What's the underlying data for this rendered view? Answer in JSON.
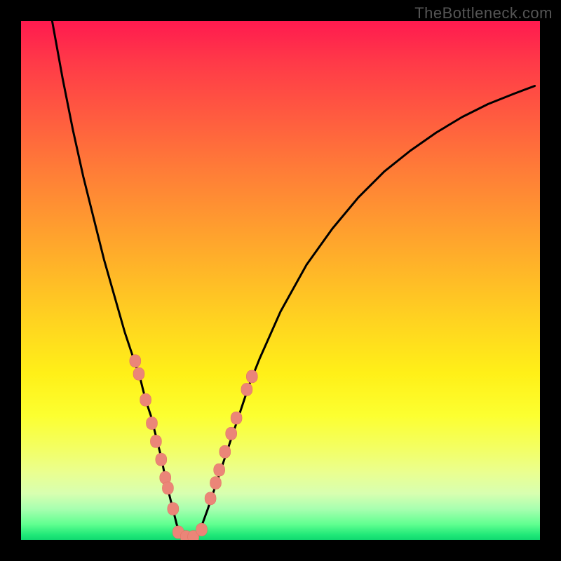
{
  "watermark": "TheBottleneck.com",
  "colors": {
    "background": "#000000",
    "marker": "#eb8578",
    "curve": "#000000"
  },
  "chart_data": {
    "type": "line",
    "title": "",
    "xlabel": "",
    "ylabel": "",
    "xlim": [
      0,
      100
    ],
    "ylim": [
      0,
      100
    ],
    "grid": false,
    "curve_left": {
      "x": [
        6,
        8,
        10,
        12,
        14,
        16,
        18,
        20,
        21,
        22,
        23,
        24,
        25,
        26,
        27,
        28,
        29,
        30,
        31
      ],
      "y": [
        100,
        89,
        79,
        70,
        62,
        54,
        47,
        40,
        37,
        34,
        31,
        27,
        24,
        20,
        16,
        11,
        7,
        3,
        0.5
      ]
    },
    "curve_right": {
      "x": [
        34,
        36,
        38,
        40,
        42,
        44,
        46,
        50,
        55,
        60,
        65,
        70,
        75,
        80,
        85,
        90,
        95,
        99
      ],
      "y": [
        0.5,
        6,
        12,
        18,
        24,
        30,
        35,
        44,
        53,
        60,
        66,
        71,
        75,
        78.5,
        81.5,
        84,
        86,
        87.5
      ]
    },
    "flat_bottom": {
      "x": [
        31,
        34
      ],
      "y": [
        0.5,
        0.5
      ]
    },
    "markers_left": [
      {
        "x": 22.0,
        "y": 34.5
      },
      {
        "x": 22.7,
        "y": 32.0
      },
      {
        "x": 24.0,
        "y": 27.0
      },
      {
        "x": 25.2,
        "y": 22.5
      },
      {
        "x": 26.0,
        "y": 19.0
      },
      {
        "x": 27.0,
        "y": 15.5
      },
      {
        "x": 27.8,
        "y": 12.0
      },
      {
        "x": 28.3,
        "y": 10.0
      },
      {
        "x": 29.3,
        "y": 6.0
      }
    ],
    "markers_right": [
      {
        "x": 36.5,
        "y": 8.0
      },
      {
        "x": 37.5,
        "y": 11.0
      },
      {
        "x": 38.2,
        "y": 13.5
      },
      {
        "x": 39.3,
        "y": 17.0
      },
      {
        "x": 40.5,
        "y": 20.5
      },
      {
        "x": 41.5,
        "y": 23.5
      },
      {
        "x": 43.5,
        "y": 29.0
      },
      {
        "x": 44.5,
        "y": 31.5
      }
    ],
    "markers_bottom": [
      {
        "x": 30.3,
        "y": 1.5
      },
      {
        "x": 31.8,
        "y": 0.6
      },
      {
        "x": 33.2,
        "y": 0.6
      },
      {
        "x": 34.8,
        "y": 2.0
      }
    ]
  }
}
